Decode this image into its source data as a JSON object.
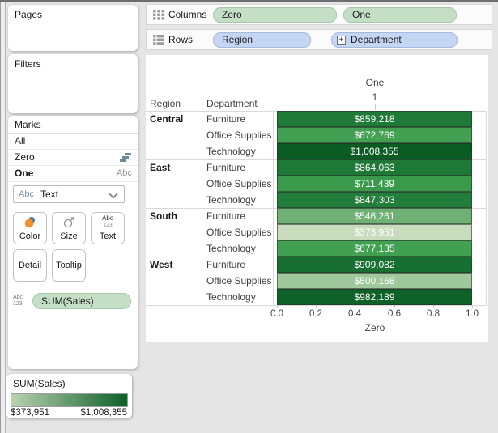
{
  "shelves": {
    "columns": {
      "label": "Columns",
      "pills": [
        "Zero",
        "One"
      ]
    },
    "rows": {
      "label": "Rows",
      "pills": [
        "Region",
        "Department"
      ]
    }
  },
  "panels": {
    "pages": {
      "title": "Pages"
    },
    "filters": {
      "title": "Filters"
    },
    "marks": {
      "title": "Marks",
      "layers": [
        {
          "label": "All",
          "right_icon": ""
        },
        {
          "label": "Zero",
          "right_icon": "gantt-bar"
        },
        {
          "label": "One",
          "right_icon": "Abc"
        }
      ],
      "type_dropdown": {
        "icon": "Abc",
        "value": "Text"
      },
      "buttons": [
        "Color",
        "Size",
        "Text",
        "Detail",
        "Tooltip"
      ],
      "text_button_icon": {
        "line1": "Abc",
        "line2": "123"
      },
      "fields": [
        {
          "icon_line1": "Abc",
          "icon_line2": "123",
          "label": "SUM(Sales)"
        }
      ]
    }
  },
  "legend": {
    "title": "SUM(Sales)",
    "min": "$373,951",
    "max": "$1,008,355",
    "gradient_start": "#b9d3ae",
    "gradient_end": "#0c5f27"
  },
  "chart": {
    "column_field": "One",
    "column_value": "1",
    "header_region": "Region",
    "header_department": "Department",
    "axis_ticks": [
      "0.0",
      "0.2",
      "0.4",
      "0.6",
      "0.8",
      "1.0"
    ],
    "axis_title": "Zero",
    "rows": [
      {
        "region": "Central",
        "department": "Furniture",
        "value": "$859,218",
        "color": "#1f7a37"
      },
      {
        "region": "",
        "department": "Office Supplies",
        "value": "$672,769",
        "color": "#43a052"
      },
      {
        "region": "",
        "department": "Technology",
        "value": "$1,008,355",
        "color": "#0b5c24"
      },
      {
        "region": "East",
        "department": "Furniture",
        "value": "$864,063",
        "color": "#1e7936"
      },
      {
        "region": "",
        "department": "Office Supplies",
        "value": "$711,439",
        "color": "#3a9a4b"
      },
      {
        "region": "",
        "department": "Technology",
        "value": "$847,303",
        "color": "#227e3a"
      },
      {
        "region": "South",
        "department": "Furniture",
        "value": "$546,261",
        "color": "#6fb174"
      },
      {
        "region": "",
        "department": "Office Supplies",
        "value": "$373,951",
        "color": "#c7dbbd"
      },
      {
        "region": "",
        "department": "Technology",
        "value": "$677,135",
        "color": "#41a051"
      },
      {
        "region": "West",
        "department": "Furniture",
        "value": "$909,082",
        "color": "#176f31"
      },
      {
        "region": "",
        "department": "Office Supplies",
        "value": "$500,168",
        "color": "#9fc89c"
      },
      {
        "region": "",
        "department": "Technology",
        "value": "$982,189",
        "color": "#0e6229"
      }
    ]
  },
  "chart_data": {
    "type": "bar",
    "orientation": "horizontal",
    "column_header": "One",
    "x_axis": {
      "title": "Zero",
      "range": [
        0,
        1
      ],
      "ticks": [
        0.0,
        0.2,
        0.4,
        0.6,
        0.8,
        1.0
      ]
    },
    "color_encoding": "SUM(Sales)",
    "color_scale": {
      "min": 373951,
      "max": 1008355,
      "min_color": "#c7dbbd",
      "max_color": "#0b5e26"
    },
    "rows": [
      {
        "region": "Central",
        "department": "Furniture",
        "sales": 859218
      },
      {
        "region": "Central",
        "department": "Office Supplies",
        "sales": 672769
      },
      {
        "region": "Central",
        "department": "Technology",
        "sales": 1008355
      },
      {
        "region": "East",
        "department": "Furniture",
        "sales": 864063
      },
      {
        "region": "East",
        "department": "Office Supplies",
        "sales": 711439
      },
      {
        "region": "East",
        "department": "Technology",
        "sales": 847303
      },
      {
        "region": "South",
        "department": "Furniture",
        "sales": 546261
      },
      {
        "region": "South",
        "department": "Office Supplies",
        "sales": 373951
      },
      {
        "region": "South",
        "department": "Technology",
        "sales": 677135
      },
      {
        "region": "West",
        "department": "Furniture",
        "sales": 909082
      },
      {
        "region": "West",
        "department": "Office Supplies",
        "sales": 500168
      },
      {
        "region": "West",
        "department": "Technology",
        "sales": 982189
      }
    ]
  }
}
